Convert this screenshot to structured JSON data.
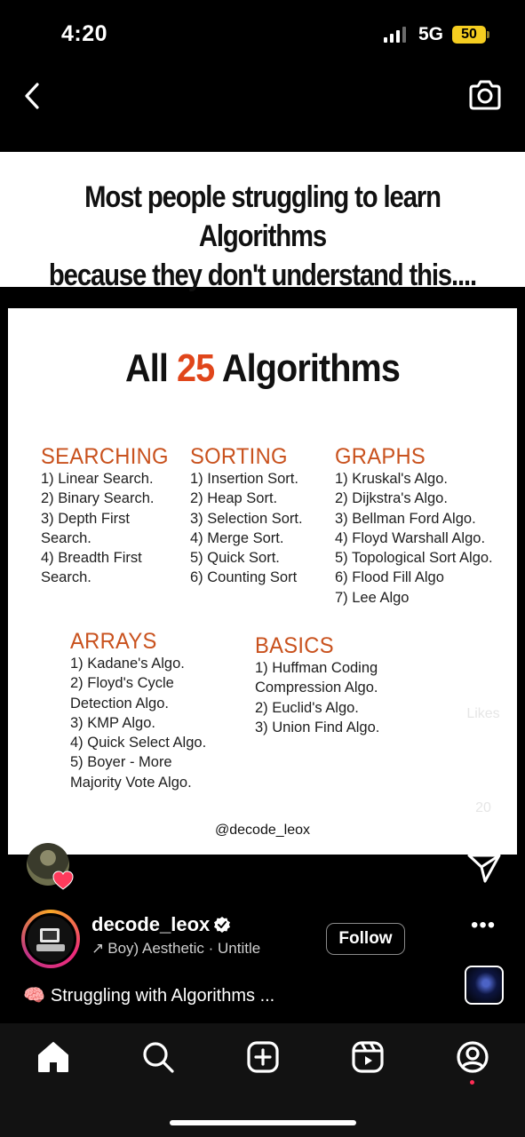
{
  "status_bar": {
    "time": "4:20",
    "network": "5G",
    "battery": "50"
  },
  "post": {
    "headline": [
      "Most people struggling to learn Algorithms",
      "because they don't understand this...."
    ],
    "card": {
      "title_prefix": "All ",
      "title_number": "25",
      "title_suffix": " Algorithms",
      "categories": [
        {
          "name": "SEARCHING",
          "items": [
            "1) Linear Search.",
            "2) Binary Search.",
            "3) Depth First\nSearch.",
            "4) Breadth First\nSearch."
          ]
        },
        {
          "name": "SORTING",
          "items": [
            "1) Insertion Sort.",
            "2) Heap Sort.",
            "3) Selection Sort.",
            "4) Merge Sort.",
            "5) Quick Sort.",
            "6) Counting Sort"
          ]
        },
        {
          "name": "GRAPHS",
          "items": [
            "1) Kruskal's Algo.",
            "2) Dijkstra's Algo.",
            "3) Bellman Ford Algo.",
            "4) Floyd Warshall Algo.",
            "5) Topological Sort Algo.",
            "6) Flood Fill Algo",
            "7) Lee Algo"
          ]
        },
        {
          "name": "ARRAYS",
          "items": [
            "1) Kadane's Algo.",
            "2) Floyd's Cycle\nDetection Algo.",
            "3) KMP Algo.",
            "4) Quick Select Algo.",
            "5) Boyer - More\nMajority Vote Algo."
          ]
        },
        {
          "name": "BASICS",
          "items": [
            "1) Huffman Coding\nCompression Algo.",
            "2) Euclid's Algo.",
            "3) Union Find Algo."
          ]
        }
      ],
      "watermark": "@decode_leox"
    }
  },
  "actions": {
    "likes_label": "Likes",
    "comments_count": "20"
  },
  "author": {
    "username": "decode_leox",
    "audio": "Boy)   Aesthetic · Untitle",
    "follow_label": "Follow",
    "more": "•••"
  },
  "caption": {
    "emoji": "🧠",
    "text": "Struggling with Algorithms ..."
  },
  "colors": {
    "accent_orange": "#c9521e",
    "title_number": "#e0461b",
    "notification_dot": "#ff2d55",
    "battery": "#f5cd20"
  },
  "icons": [
    "back-chevron-icon",
    "camera-icon",
    "heart-icon",
    "comment-icon",
    "send-icon",
    "verified-icon",
    "home-icon",
    "search-icon",
    "create-icon",
    "reels-icon",
    "profile-icon"
  ]
}
